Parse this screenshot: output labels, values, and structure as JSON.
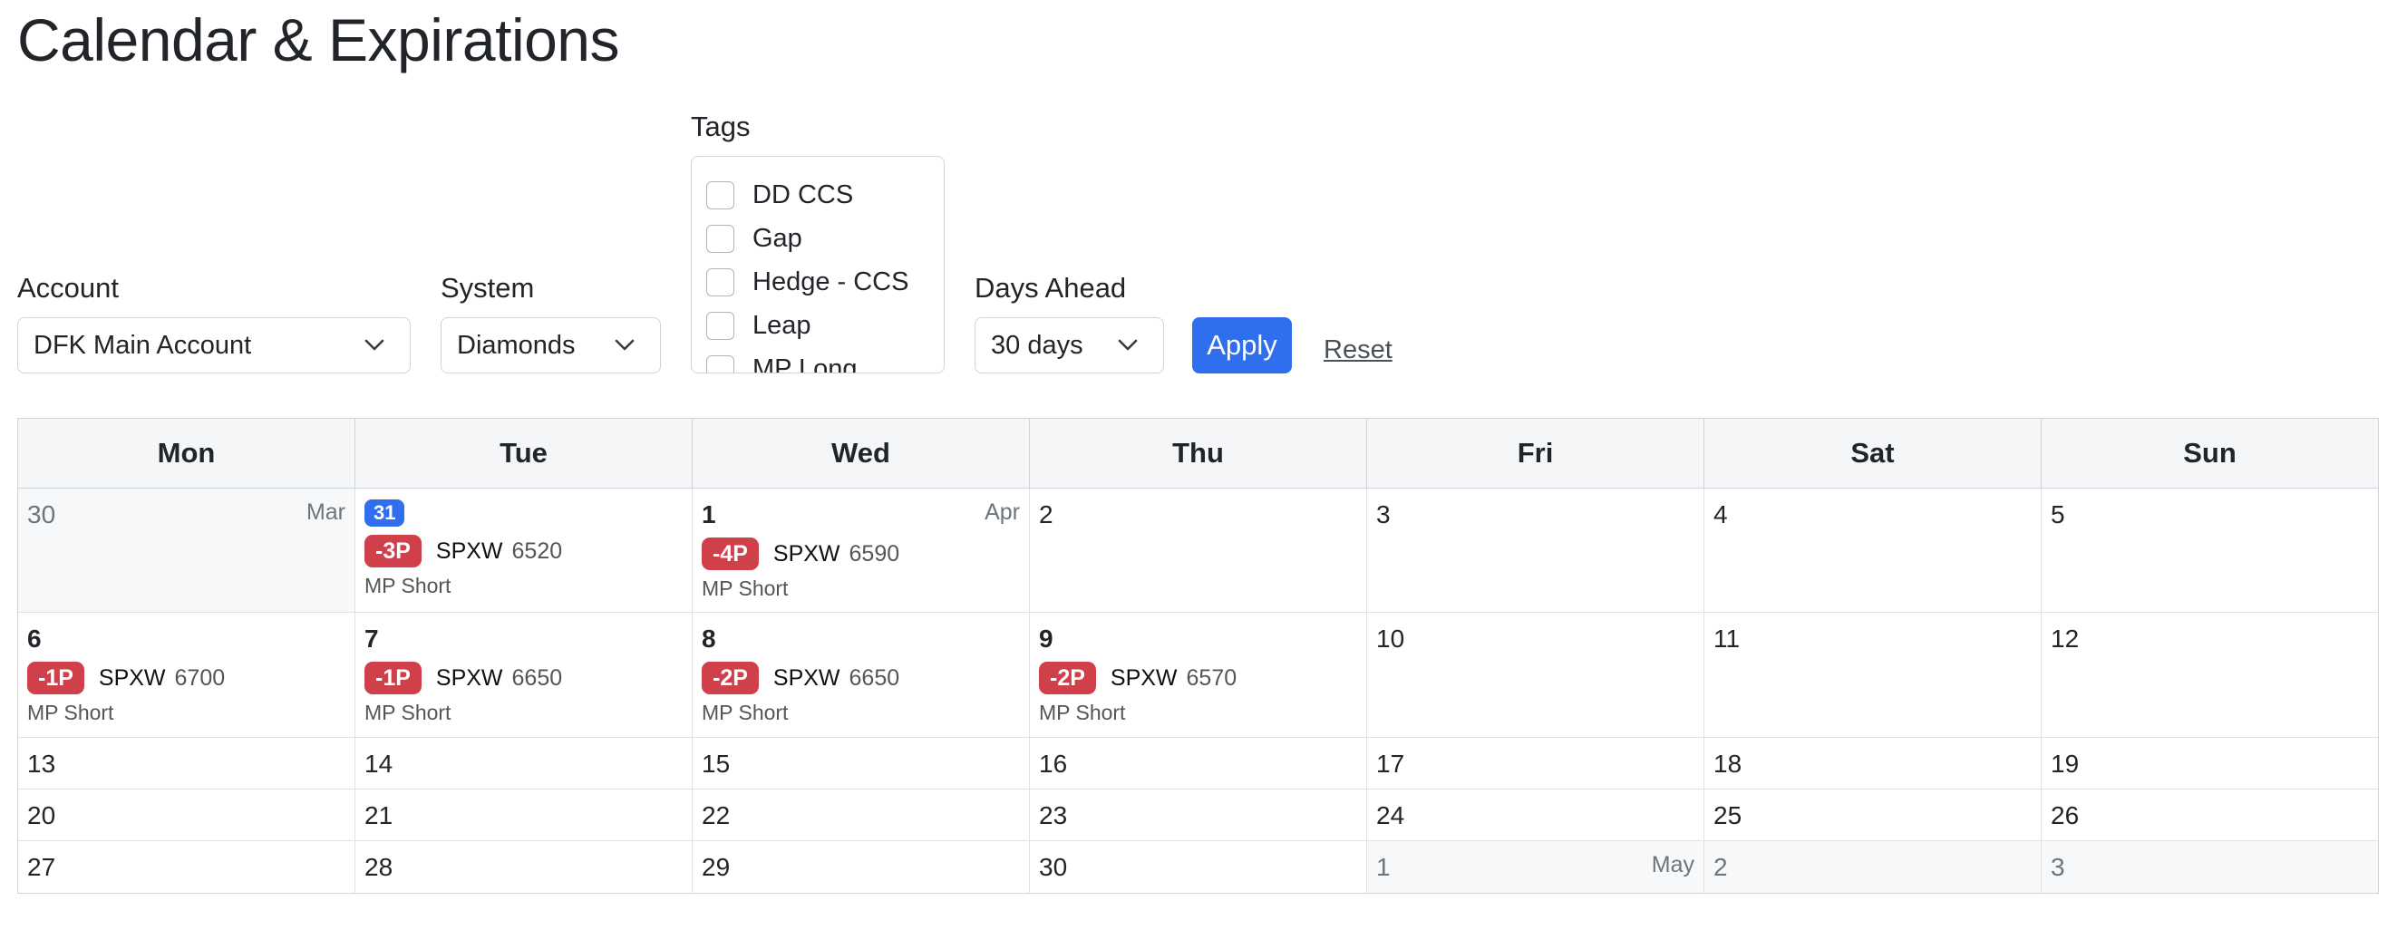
{
  "page": {
    "title": "Calendar & Expirations"
  },
  "filters": {
    "account": {
      "label": "Account",
      "value": "DFK Main Account"
    },
    "system": {
      "label": "System",
      "value": "Diamonds"
    },
    "tags": {
      "label": "Tags",
      "options": [
        "DD CCS",
        "Gap",
        "Hedge - CCS",
        "Leap",
        "MP Long"
      ]
    },
    "days_ahead": {
      "label": "Days Ahead",
      "value": "30 days"
    },
    "apply_label": "Apply",
    "reset_label": "Reset"
  },
  "calendar": {
    "weekdays": [
      "Mon",
      "Tue",
      "Wed",
      "Thu",
      "Fri",
      "Sat",
      "Sun"
    ],
    "weeks": [
      [
        {
          "day": "30",
          "month": "Mar",
          "other": true
        },
        {
          "day": "31",
          "today": true,
          "events": [
            {
              "qty": "-3P",
              "symbol": "SPXW",
              "strike": "6520",
              "system": "MP Short"
            }
          ]
        },
        {
          "day": "1",
          "month": "Apr",
          "bold": true,
          "events": [
            {
              "qty": "-4P",
              "symbol": "SPXW",
              "strike": "6590",
              "system": "MP Short"
            }
          ]
        },
        {
          "day": "2"
        },
        {
          "day": "3"
        },
        {
          "day": "4"
        },
        {
          "day": "5"
        }
      ],
      [
        {
          "day": "6",
          "bold": true,
          "events": [
            {
              "qty": "-1P",
              "symbol": "SPXW",
              "strike": "6700",
              "system": "MP Short"
            }
          ]
        },
        {
          "day": "7",
          "bold": true,
          "events": [
            {
              "qty": "-1P",
              "symbol": "SPXW",
              "strike": "6650",
              "system": "MP Short"
            }
          ]
        },
        {
          "day": "8",
          "bold": true,
          "events": [
            {
              "qty": "-2P",
              "symbol": "SPXW",
              "strike": "6650",
              "system": "MP Short"
            }
          ]
        },
        {
          "day": "9",
          "bold": true,
          "events": [
            {
              "qty": "-2P",
              "symbol": "SPXW",
              "strike": "6570",
              "system": "MP Short"
            }
          ]
        },
        {
          "day": "10"
        },
        {
          "day": "11"
        },
        {
          "day": "12"
        }
      ],
      [
        {
          "day": "13"
        },
        {
          "day": "14"
        },
        {
          "day": "15"
        },
        {
          "day": "16"
        },
        {
          "day": "17"
        },
        {
          "day": "18"
        },
        {
          "day": "19"
        }
      ],
      [
        {
          "day": "20"
        },
        {
          "day": "21"
        },
        {
          "day": "22"
        },
        {
          "day": "23"
        },
        {
          "day": "24"
        },
        {
          "day": "25"
        },
        {
          "day": "26"
        }
      ],
      [
        {
          "day": "27"
        },
        {
          "day": "28"
        },
        {
          "day": "29"
        },
        {
          "day": "30"
        },
        {
          "day": "1",
          "month": "May",
          "other": true
        },
        {
          "day": "2",
          "other": true
        },
        {
          "day": "3",
          "other": true
        }
      ]
    ]
  },
  "colors": {
    "primary": "#2f6fed",
    "danger": "#d0404a",
    "border": "#ced4da"
  }
}
